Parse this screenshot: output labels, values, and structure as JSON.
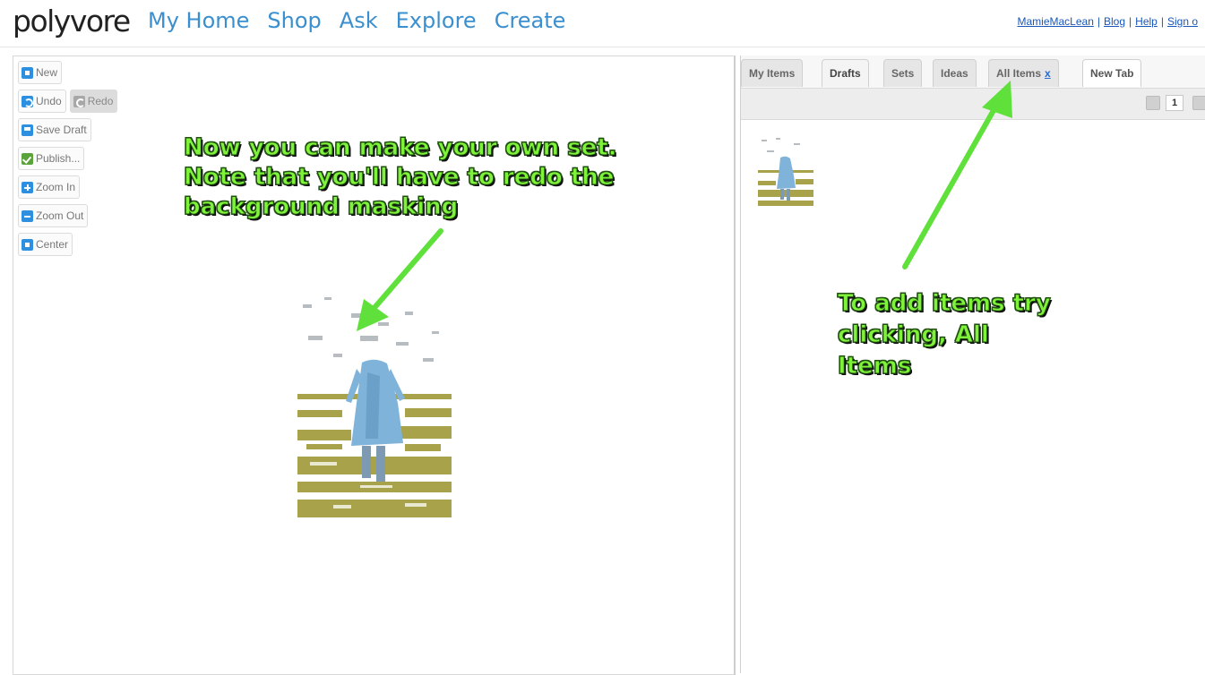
{
  "header": {
    "logo": "polyvore",
    "nav": [
      "My Home",
      "Shop",
      "Ask",
      "Explore",
      "Create"
    ],
    "user_links": {
      "username": "MamieMacLean",
      "blog": "Blog",
      "help": "Help",
      "sign_out": "Sign o"
    }
  },
  "toolbar": {
    "new": "New",
    "undo": "Undo",
    "redo": "Redo",
    "save_draft": "Save Draft",
    "publish": "Publish...",
    "zoom_in": "Zoom In",
    "zoom_out": "Zoom Out",
    "center": "Center"
  },
  "annotations": {
    "canvas_note": "Now you can make your own set. Note that you'll have to redo the background masking",
    "tab_note": "To add items try clicking, All Items"
  },
  "right_panel": {
    "tabs": [
      {
        "label": "My Items"
      },
      {
        "label": "Drafts"
      },
      {
        "label": "Sets"
      },
      {
        "label": "Ideas"
      },
      {
        "label": "All Items",
        "close": "x"
      },
      {
        "label": "New Tab"
      }
    ],
    "page": "1"
  },
  "colors": {
    "nav_link": "#3b8fce",
    "annotation_text": "#7ff23a",
    "annotation_arrow": "#5fe03a",
    "icon_blue": "#2c8fe0",
    "icon_green": "#5aa33a"
  }
}
